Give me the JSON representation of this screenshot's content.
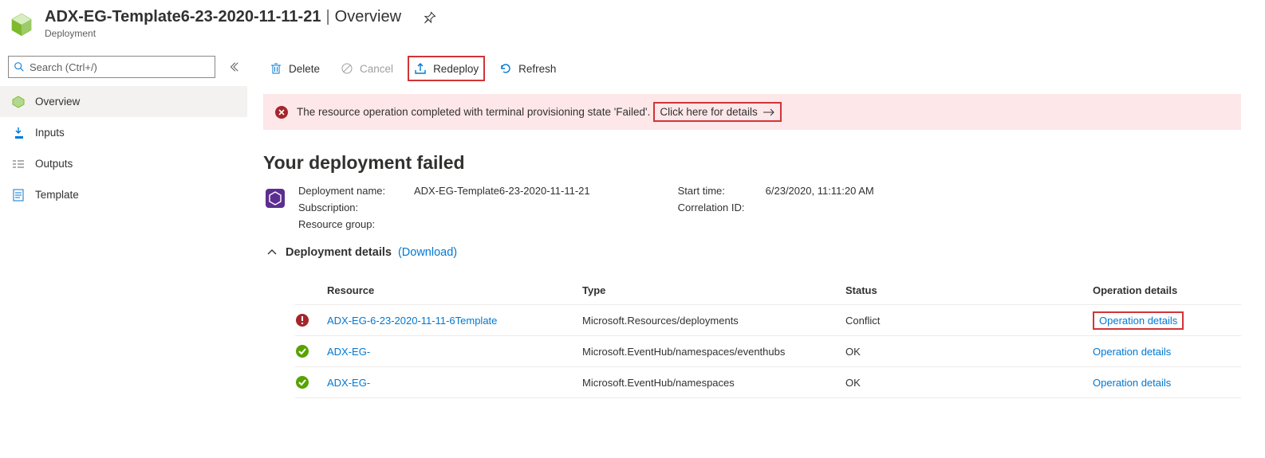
{
  "header": {
    "title": "ADX-EG-Template6-23-2020-11-11-21",
    "section": "Overview",
    "subtype": "Deployment"
  },
  "search": {
    "placeholder": "Search (Ctrl+/)"
  },
  "nav": {
    "overview": "Overview",
    "inputs": "Inputs",
    "outputs": "Outputs",
    "template": "Template"
  },
  "toolbar": {
    "delete": "Delete",
    "cancel": "Cancel",
    "redeploy": "Redeploy",
    "refresh": "Refresh"
  },
  "alert": {
    "message": "The resource operation completed with terminal provisioning state 'Failed'.",
    "link_text": "Click here for details"
  },
  "main_heading": "Your deployment failed",
  "meta": {
    "deployment_name_label": "Deployment name:",
    "deployment_name_value": "ADX-EG-Template6-23-2020-11-11-21",
    "subscription_label": "Subscription:",
    "subscription_value": "",
    "resource_group_label": "Resource group:",
    "resource_group_value": "",
    "start_time_label": "Start time:",
    "start_time_value": "6/23/2020, 11:11:20 AM",
    "correlation_id_label": "Correlation ID:",
    "correlation_id_value": ""
  },
  "details": {
    "title": "Deployment details",
    "download": "(Download)",
    "columns": {
      "resource": "Resource",
      "type": "Type",
      "status": "Status",
      "op": "Operation details"
    },
    "rows": [
      {
        "status": "error",
        "resource": "ADX-EG-6-23-2020-11-11-6Template",
        "type": "Microsoft.Resources/deployments",
        "status_text": "Conflict",
        "op": "Operation details",
        "highlight": true
      },
      {
        "status": "ok",
        "resource": "ADX-EG-",
        "type": "Microsoft.EventHub/namespaces/eventhubs",
        "status_text": "OK",
        "op": "Operation details",
        "highlight": false
      },
      {
        "status": "ok",
        "resource": "ADX-EG-",
        "type": "Microsoft.EventHub/namespaces",
        "status_text": "OK",
        "op": "Operation details",
        "highlight": false
      }
    ]
  }
}
